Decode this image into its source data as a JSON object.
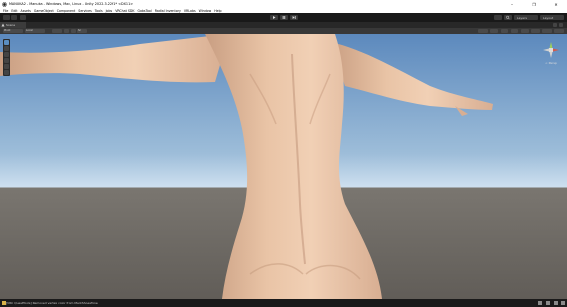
{
  "window": {
    "title": "MANUKA2 - Manuka - Windows, Mac, Linux - Unity 2022.3.22f1* <DX11>",
    "controls": [
      "–",
      "❐",
      "✕"
    ]
  },
  "menu": [
    "File",
    "Edit",
    "Assets",
    "GameObject",
    "Component",
    "Services",
    "Tools",
    "Jobs",
    "VRChat SDK",
    "GabsTool",
    "Radial Inventory",
    "VRLabs",
    "Window",
    "Help"
  ],
  "toolbar": {
    "layers_label": "Layers",
    "layout_label": "Layout"
  },
  "tabs": {
    "scene": "Scene"
  },
  "scene_toolbar": {
    "pivot": "Pivot",
    "local": "Local",
    "grid_value": "Sc",
    "persp_label": "< Persp"
  },
  "status": {
    "message": "[VRC QuestTools] Removed vertex color from MarkShoesTone"
  },
  "colors": {
    "sky_top": "#5c89bd",
    "sky_horizon": "#cfe0f0",
    "ground": "#6d6963",
    "skin": "#e9c4a6",
    "skin_shadow": "#c59a7e",
    "accent": "#5a8ec2"
  },
  "icons": {
    "unity_logo": "unity-logo-icon",
    "play": "play-icon",
    "pause": "pause-icon",
    "step": "step-icon",
    "search": "search-icon",
    "layers": "layers-icon",
    "gizmo": "axis-gizmo-icon"
  }
}
